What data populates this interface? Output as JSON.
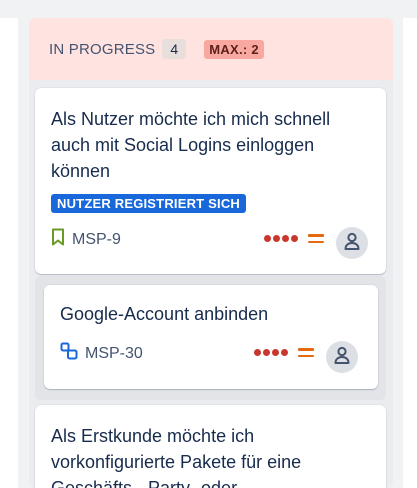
{
  "column": {
    "title": "IN PROGRESS",
    "count": "4",
    "max_label": "MAX.: 2",
    "header_color": "#ffe3e0"
  },
  "cards": [
    {
      "title": "Als Nutzer möchte ich mich schnell auch mit Social Logins einloggen können",
      "epic": "NUTZER REGISTRIERT SICH",
      "key": "MSP-9",
      "type_icon": "story-bookmark-icon",
      "priority_icon": "priority-highest-icon",
      "status_icon": "medium-equals-icon",
      "assignee": "unassigned-avatar"
    },
    {
      "title": "Google-Account anbinden",
      "key": "MSP-30",
      "type_icon": "subtask-icon",
      "priority_icon": "priority-highest-icon",
      "status_icon": "medium-equals-icon",
      "assignee": "unassigned-avatar"
    },
    {
      "title": "Als Erstkunde möchte ich vorkonfigurierte Pakete für eine Geschäfts-, Party- oder"
    }
  ],
  "colors": {
    "epic_bg": "#1868db",
    "priority_dots": "#c9372c",
    "priority_equals": "#e56910",
    "story_icon": "#6a9a23",
    "subtask_icon": "#1868db"
  }
}
